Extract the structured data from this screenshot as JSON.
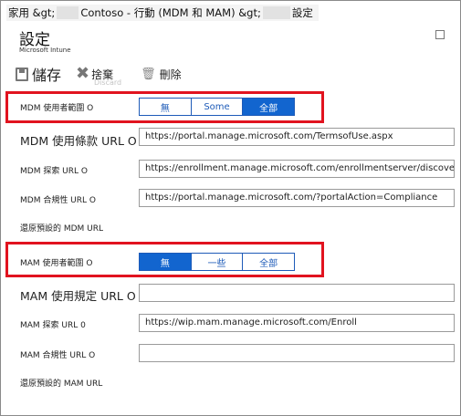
{
  "breadcrumb": {
    "home": "家用 &gt;",
    "app": "Contoso - 行動 (MDM 和 MAM) &gt;",
    "current": "設定"
  },
  "blade": {
    "title": "設定",
    "subtitle": "Microsoft Intune"
  },
  "toolbar": {
    "save": "儲存",
    "discard": "捨棄",
    "discard_ghost": "Discard",
    "delete": "刪除"
  },
  "mdm": {
    "scope_label": "MDM 使用者範圍 O",
    "scope_options": [
      "無",
      "Some",
      "全部"
    ],
    "scope_selected": "全部",
    "terms_label": "MDM 使用條款 URL O",
    "terms_value": "https://portal.manage.microsoft.com/TermsofUse.aspx",
    "discovery_label": "MDM 探索 URL O",
    "discovery_value": "https://enrollment.manage.microsoft.com/enrollmentserver/discovery",
    "compliance_label": "MDM 合規性  URL O",
    "compliance_value": "https://portal.manage.microsoft.com/?portalAction=Compliance",
    "restore_label": "還原預設的 MDM URL"
  },
  "mam": {
    "scope_label": "MAM 使用者範圍 O",
    "scope_options": [
      "無",
      "一些",
      "全部"
    ],
    "scope_selected": "無",
    "terms_label": "MAM 使用規定 URL O",
    "terms_value": "",
    "discovery_label": "MAM 探索 URL 0",
    "discovery_value": "https://wip.mam.manage.microsoft.com/Enroll",
    "compliance_label": "MAM 合規性 URL O",
    "compliance_value": "",
    "restore_label": "還原預設的 MAM URL"
  },
  "colors": {
    "accent": "#1265cf",
    "highlight": "#e1131f"
  }
}
